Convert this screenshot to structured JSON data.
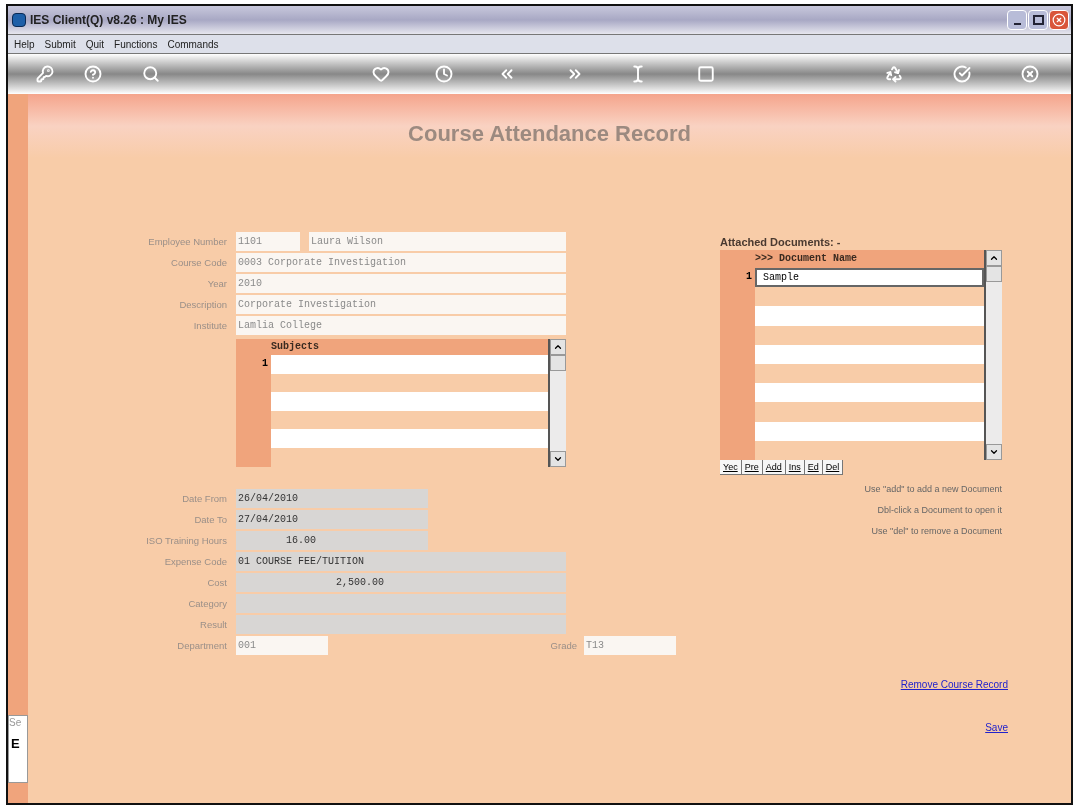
{
  "window": {
    "title": "IES Client(Q) v8.26 : My IES"
  },
  "menu": [
    "Help",
    "Submit",
    "Quit",
    "Functions",
    "Commands"
  ],
  "page_title": "Course Attendance Record",
  "top_fields": [
    {
      "label": "Employee Number",
      "value": "1101",
      "name": "Laura Wilson"
    },
    {
      "label": "Course Code",
      "value": "0003 Corporate Investigation"
    },
    {
      "label": "Year",
      "value": "2010"
    },
    {
      "label": "Description",
      "value": "Corporate Investigation"
    },
    {
      "label": "Institute",
      "value": "Lamlia College"
    }
  ],
  "subjects": {
    "header": "Subjects",
    "rows": [
      {
        "number": "1"
      }
    ]
  },
  "lower_fields": [
    {
      "label": "Date From",
      "value": "26/04/2010",
      "readonly": true,
      "kind": "short"
    },
    {
      "label": "Date To",
      "value": "27/04/2010",
      "readonly": true,
      "kind": "short"
    },
    {
      "label": "ISO Training Hours",
      "value": "16.00",
      "readonly": true,
      "kind": "short"
    },
    {
      "label": "Expense Code",
      "value": "01 COURSE FEE/TUITION",
      "readonly": true,
      "kind": "long"
    },
    {
      "label": "Cost",
      "value": "2,500.00",
      "readonly": true,
      "kind": "long"
    },
    {
      "label": "Category",
      "readonly": true,
      "kind": "long"
    },
    {
      "label": "Result",
      "readonly": true,
      "kind": "long"
    }
  ],
  "department": {
    "label": "Department",
    "value": "001"
  },
  "grade": {
    "label": "Grade",
    "value": "T13"
  },
  "documents": {
    "title": "Attached Documents: -",
    "header": ">>> Document Name",
    "rows": [
      {
        "number": "1",
        "name": "Sample",
        "selected": true
      }
    ],
    "buttons": [
      "Yec",
      "Pre",
      "Add",
      "Ins",
      "Ed",
      "Del"
    ],
    "hints": [
      "Use \"add\" to add a new Document",
      "Dbl-click a Document to open it",
      "Use \"del\" to remove a Document"
    ]
  },
  "links": [
    "Remove Course Record",
    "Save"
  ],
  "side_panel": {
    "label": "Se",
    "button": "E"
  }
}
